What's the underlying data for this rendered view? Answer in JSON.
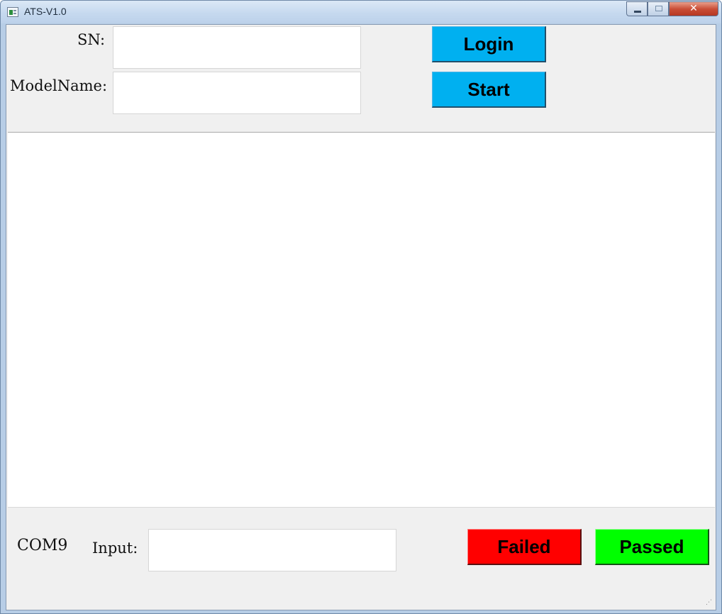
{
  "window": {
    "title": "ATS-V1.0",
    "controls": {
      "minimize": "",
      "maximize": "",
      "close": "✕"
    }
  },
  "form": {
    "sn_label": "SN:",
    "sn_value": "",
    "modelname_label": "ModelName:",
    "modelname_value": "",
    "login_button": "Login",
    "start_button": "Start"
  },
  "log": {
    "text": ""
  },
  "footer": {
    "port_label": "COM9",
    "input_label": "Input:",
    "input_value": "",
    "failed_button": "Failed",
    "passed_button": "Passed"
  },
  "colors": {
    "accent_blue": "#00b0f0",
    "fail_red": "#ff0000",
    "pass_green": "#00ff00"
  }
}
